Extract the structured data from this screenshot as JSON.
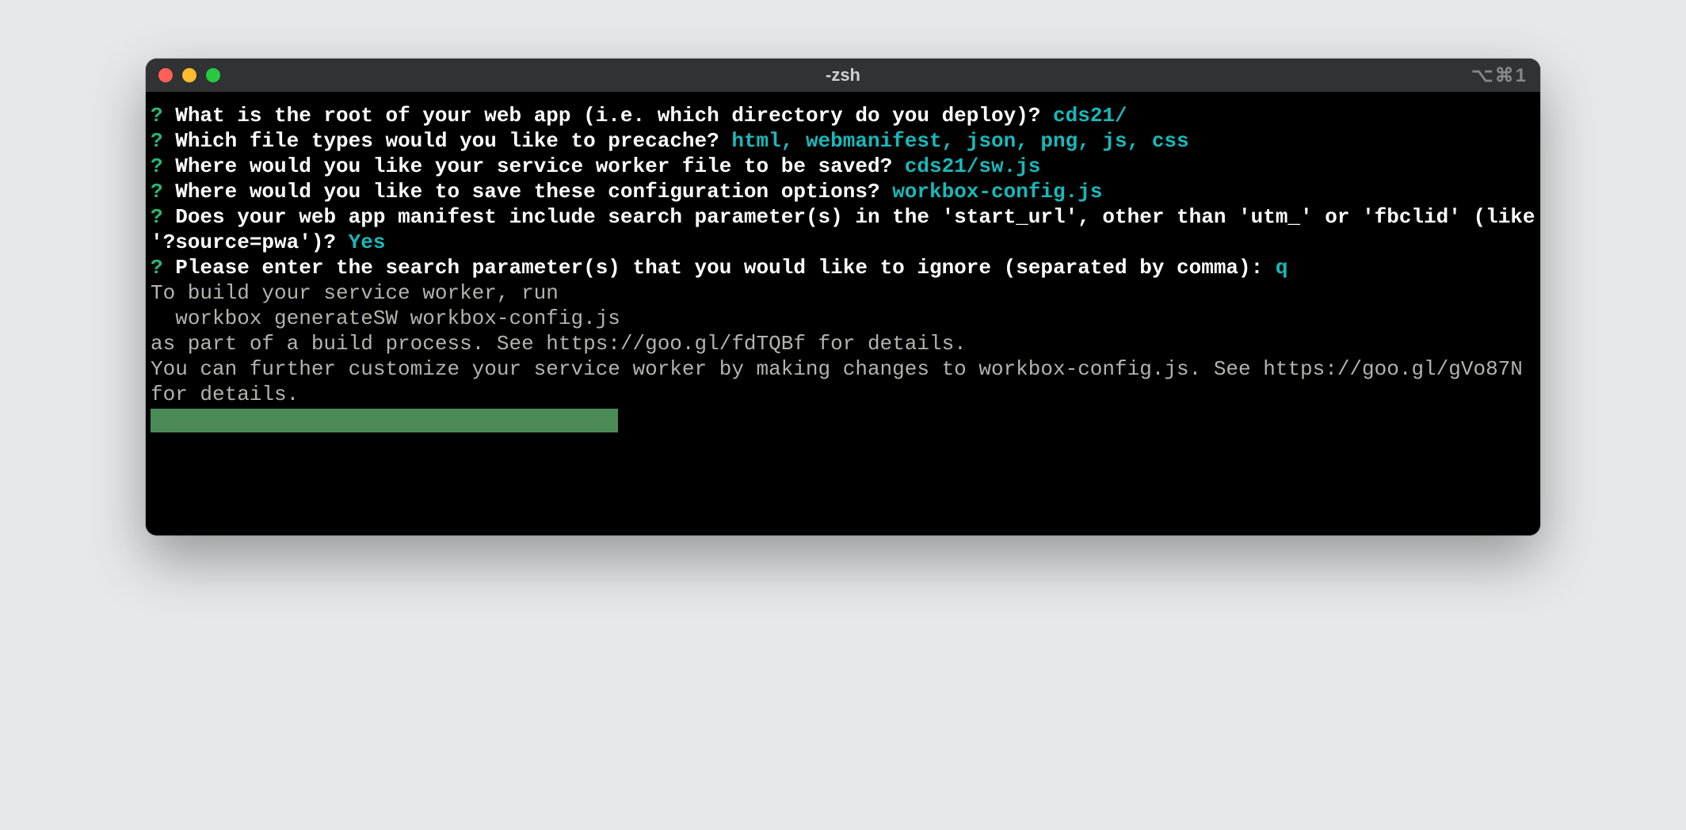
{
  "title": "-zsh",
  "title_right": "⌥⌘1",
  "prompt_mark": "?",
  "questions": [
    {
      "q": "What is the root of your web app (i.e. which directory do you deploy)?",
      "a": "cds21/"
    },
    {
      "q": "Which file types would you like to precache?",
      "a": "html, webmanifest, json, png, js, css"
    },
    {
      "q": "Where would you like your service worker file to be saved?",
      "a": "cds21/sw.js"
    },
    {
      "q": "Where would you like to save these configuration options?",
      "a": "workbox-config.js"
    },
    {
      "q": "Does your web app manifest include search parameter(s) in the 'start_url', other than 'utm_' or 'fbclid' (like '?source=pwa')?",
      "a": "Yes"
    },
    {
      "q": "Please enter the search parameter(s) that you would like to ignore (separated by comma):",
      "a": "q"
    }
  ],
  "footer": {
    "l0": "To build your service worker, run",
    "l1": "",
    "l2": "  workbox generateSW workbox-config.js",
    "l3": "",
    "l4": "as part of a build process. See https://goo.gl/fdTQBf for details.",
    "l5": "You can further customize your service worker by making changes to workbox-config.js. See https://goo.gl/gVo87N for details."
  }
}
